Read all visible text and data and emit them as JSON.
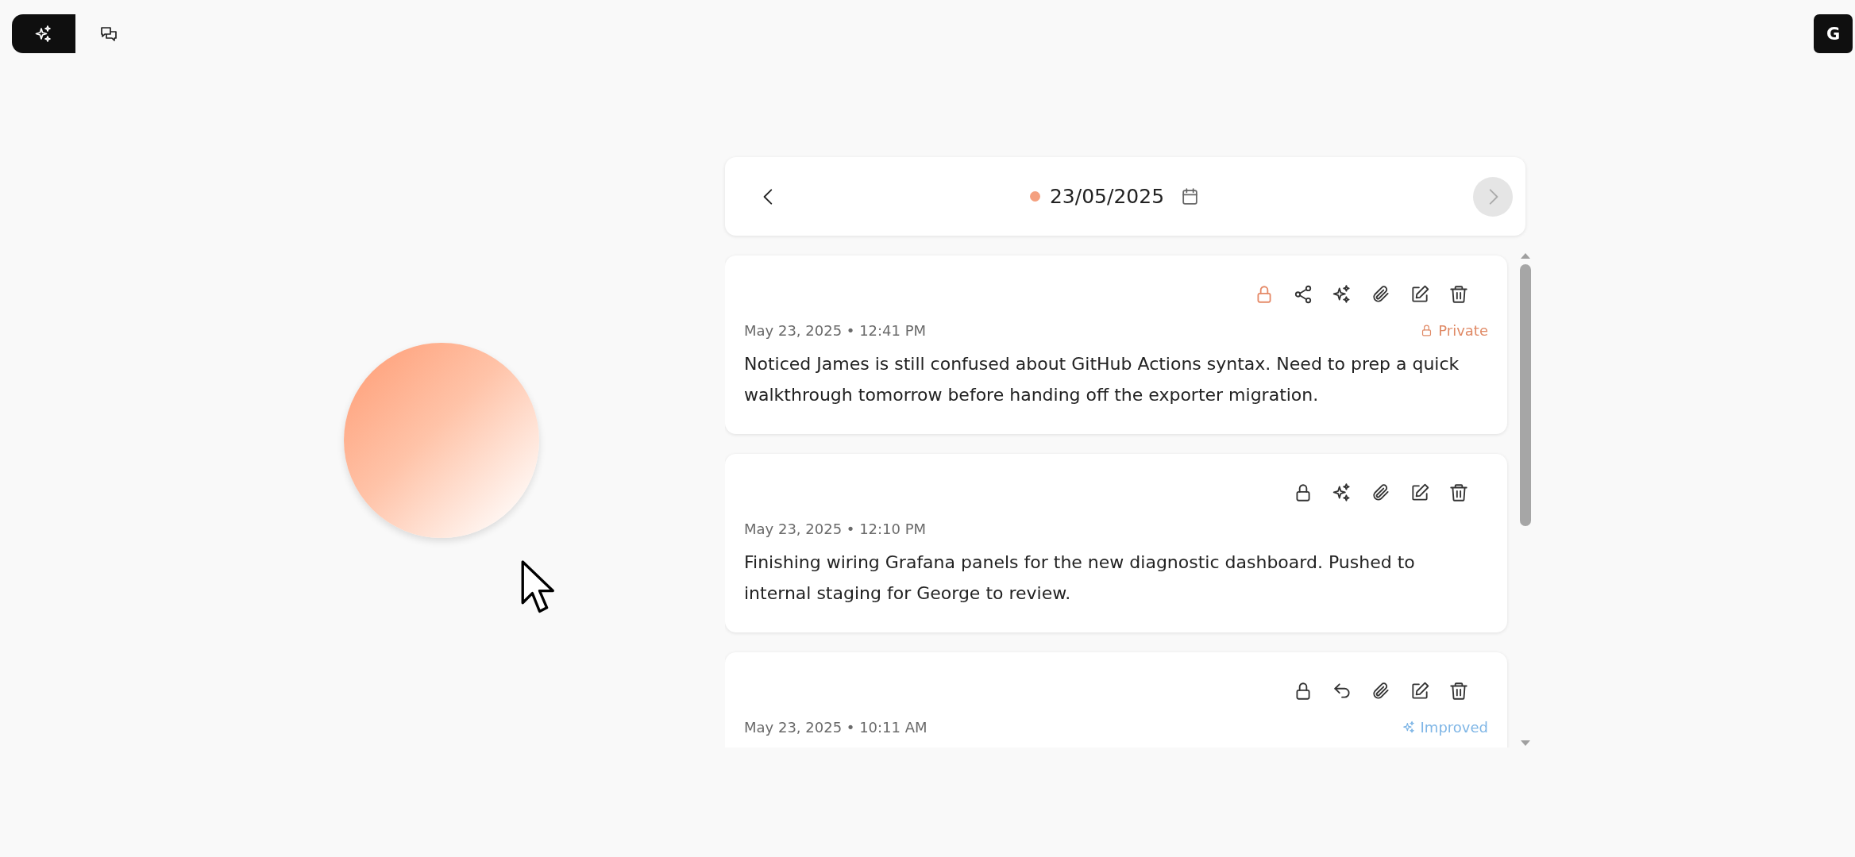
{
  "toolbar": {
    "modes": [
      {
        "kind": "ai",
        "selected": true
      },
      {
        "kind": "chat",
        "selected": false
      }
    ]
  },
  "account": {
    "initial": "G"
  },
  "date_nav": {
    "date": "23/05/2025",
    "color": "#f4a07f",
    "next_disabled": true
  },
  "notes": [
    {
      "timestamp": "May 23, 2025 • 12:41 PM",
      "text": "Noticed James is still confused about GitHub Actions syntax. Need to prep a quick walkthrough tomorrow before handing off the exporter migration.",
      "private": true,
      "actions": [
        {
          "kind": "lock"
        },
        {
          "kind": "share"
        },
        {
          "kind": "enhance"
        },
        {
          "kind": "attach"
        },
        {
          "kind": "edit"
        },
        {
          "kind": "delete"
        }
      ],
      "badge": {
        "kind": "private",
        "label": "Private"
      }
    },
    {
      "timestamp": "May 23, 2025 • 12:10 PM",
      "text": "Finishing wiring Grafana panels for the new diagnostic dashboard. Pushed to internal staging for George to review.",
      "private": false,
      "actions": [
        {
          "kind": "lock"
        },
        {
          "kind": "enhance"
        },
        {
          "kind": "attach"
        },
        {
          "kind": "edit"
        },
        {
          "kind": "delete"
        }
      ]
    },
    {
      "timestamp": "May 23, 2025 • 10:11 AM",
      "private": false,
      "actions": [
        {
          "kind": "lock"
        },
        {
          "kind": "undo"
        },
        {
          "kind": "attach"
        },
        {
          "kind": "edit"
        },
        {
          "kind": "delete"
        }
      ],
      "badge": {
        "kind": "improved",
        "label": "Improved"
      }
    }
  ]
}
